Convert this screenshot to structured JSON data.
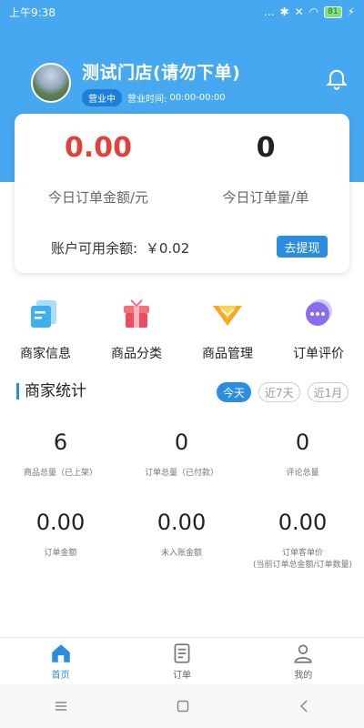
{
  "status_bar": {
    "time": "上午9:38",
    "signal_text": "...",
    "battery": "81"
  },
  "store": {
    "name": "测试门店(请勿下单)",
    "status": "营业中",
    "hours_label": "营业时间:",
    "hours_value": "00:00-00:00"
  },
  "summary": {
    "order_amount_value": "0.00",
    "order_amount_label": "今日订单金额/元",
    "order_count_value": "0",
    "order_count_label": "今日订单量/单",
    "balance_label": "账户可用余额:",
    "balance_value": "￥0.02",
    "withdraw_label": "去提现"
  },
  "shortcuts": [
    {
      "label": "商家信息",
      "icon": "merchant-info-icon"
    },
    {
      "label": "商品分类",
      "icon": "product-category-icon"
    },
    {
      "label": "商品管理",
      "icon": "product-manage-icon"
    },
    {
      "label": "订单评价",
      "icon": "order-review-icon"
    }
  ],
  "stats_section": {
    "title": "商家统计",
    "tabs": [
      "今天",
      "近7天",
      "近1月"
    ],
    "active_tab": "今天"
  },
  "stats": [
    {
      "value": "6",
      "label": "商品总量（已上架）"
    },
    {
      "value": "0",
      "label": "订单总量（已付款）"
    },
    {
      "value": "0",
      "label": "评论总量"
    },
    {
      "value": "0.00",
      "label": "订单金额"
    },
    {
      "value": "0.00",
      "label": "未入账金额"
    },
    {
      "value": "0.00",
      "label": "订单客单价",
      "sublabel": "(当前订单总金额/订单数量)"
    }
  ],
  "tabbar": [
    {
      "label": "首页",
      "icon": "home-icon",
      "active": true
    },
    {
      "label": "订单",
      "icon": "order-icon",
      "active": false
    },
    {
      "label": "我的",
      "icon": "profile-icon",
      "active": false
    }
  ],
  "colors": {
    "primary": "#46a8f0",
    "accent": "#2a8de0",
    "amount_red": "#e0413b"
  }
}
